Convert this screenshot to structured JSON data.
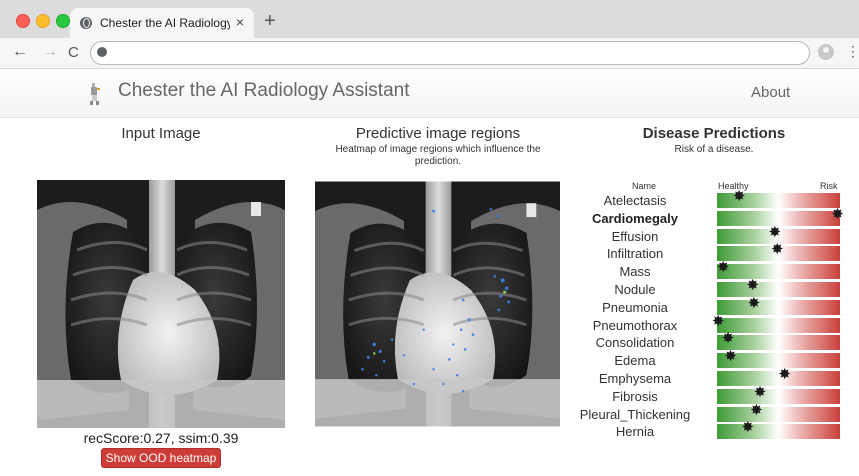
{
  "browser": {
    "tab_title": "Chester the AI Radiology Assis",
    "tab_close": "×",
    "new_tab": "+",
    "back": "←",
    "forward": "→",
    "reload": "C",
    "menu": "⋮"
  },
  "navbar": {
    "brand": "Chester the AI Radiology Assistant",
    "about": "About"
  },
  "input_panel": {
    "title": "Input Image",
    "rec_score": "recScore:0.27, ssim:0.39",
    "ood_button": "Show OOD heatmap"
  },
  "heatmap_panel": {
    "title": "Predictive image regions",
    "subtitle": "Heatmap of image regions which influence the prediction."
  },
  "disease_panel": {
    "title": "Disease Predictions",
    "subtitle": "Risk of a disease.",
    "col_name": "Name",
    "col_healthy": "Healthy",
    "col_risk": "Risk",
    "marker_glyph": "✸",
    "predictions": [
      {
        "name": "Atelectasis",
        "risk": 0.18,
        "bold": false
      },
      {
        "name": "Cardiomegaly",
        "risk": 0.98,
        "bold": true
      },
      {
        "name": "Effusion",
        "risk": 0.47,
        "bold": false
      },
      {
        "name": "Infiltration",
        "risk": 0.49,
        "bold": false
      },
      {
        "name": "Mass",
        "risk": 0.05,
        "bold": false
      },
      {
        "name": "Nodule",
        "risk": 0.29,
        "bold": false
      },
      {
        "name": "Pneumonia",
        "risk": 0.3,
        "bold": false
      },
      {
        "name": "Pneumothorax",
        "risk": 0.01,
        "bold": false
      },
      {
        "name": "Consolidation",
        "risk": 0.09,
        "bold": false
      },
      {
        "name": "Edema",
        "risk": 0.11,
        "bold": false
      },
      {
        "name": "Emphysema",
        "risk": 0.55,
        "bold": false
      },
      {
        "name": "Fibrosis",
        "risk": 0.35,
        "bold": false
      },
      {
        "name": "Pleural_Thickening",
        "risk": 0.32,
        "bold": false
      },
      {
        "name": "Hernia",
        "risk": 0.25,
        "bold": false
      }
    ]
  }
}
